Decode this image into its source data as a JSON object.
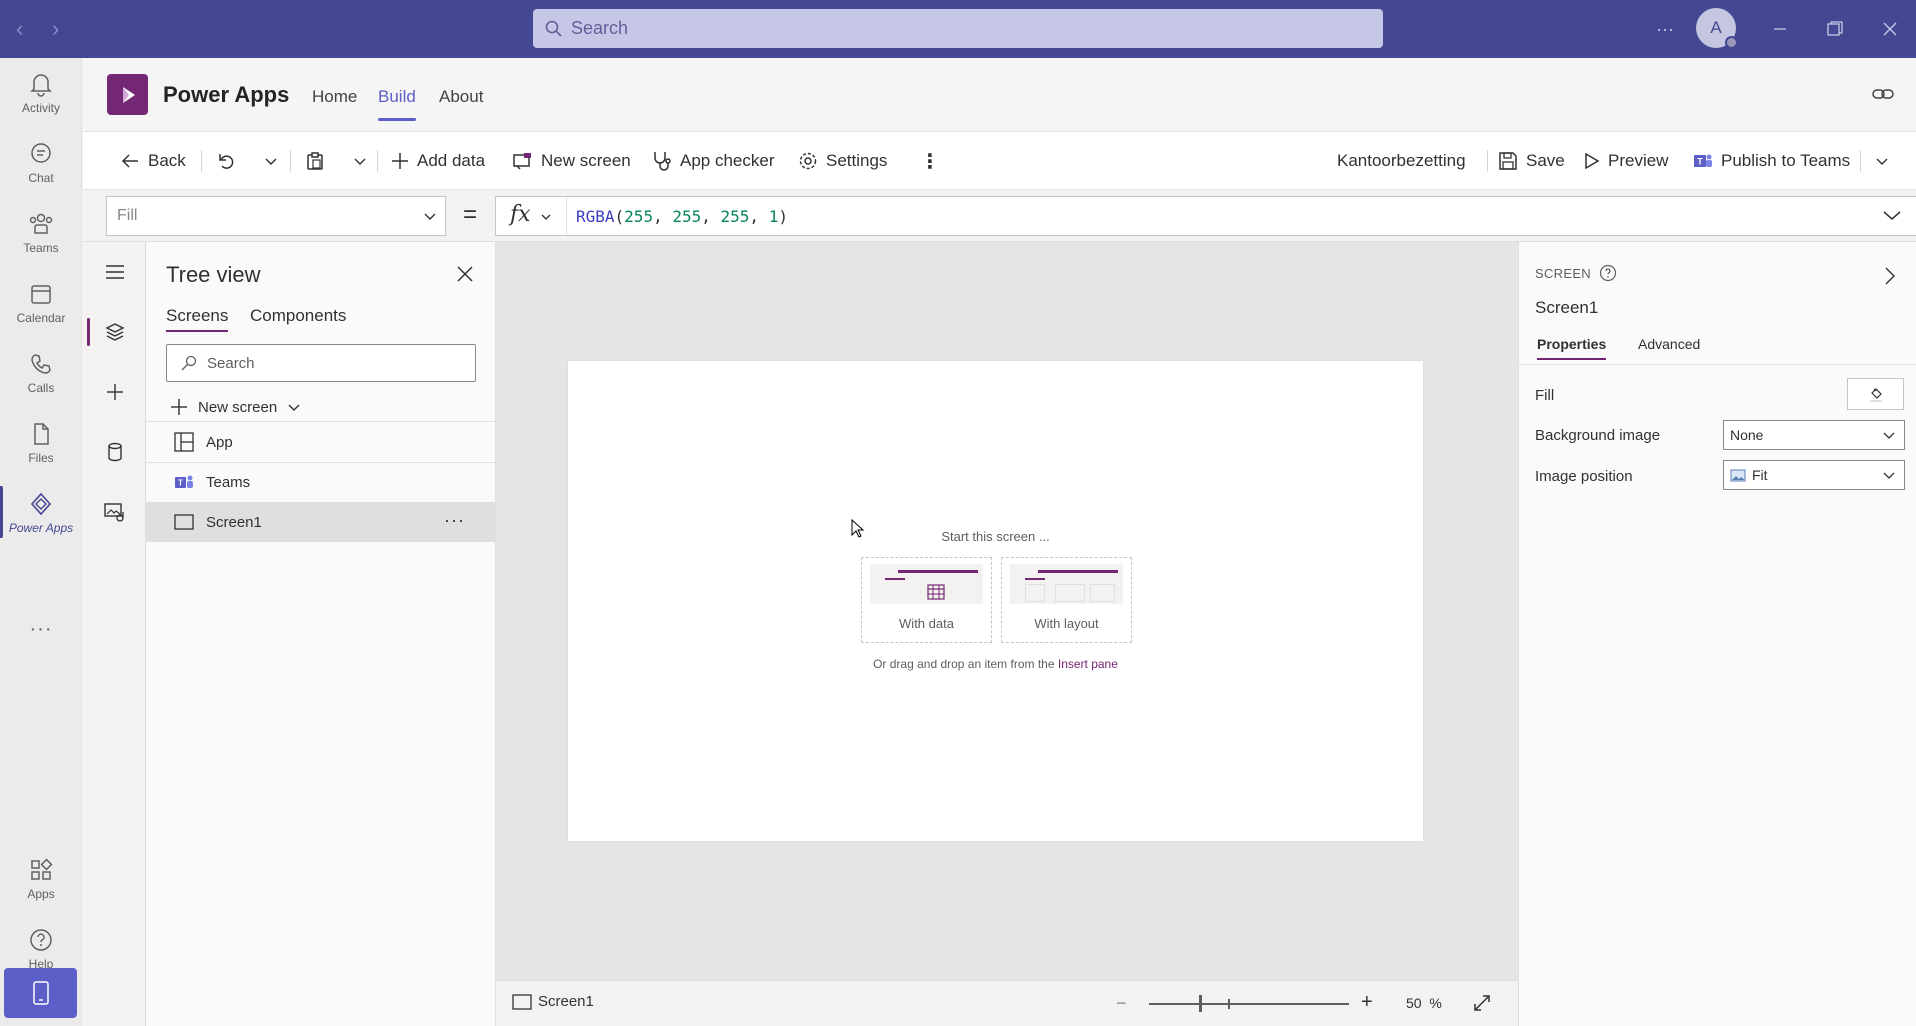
{
  "titlebar": {
    "search_placeholder": "Search",
    "avatar_initial": "A",
    "more": "···"
  },
  "rail": {
    "items": [
      {
        "label": "Activity",
        "icon": "bell-icon"
      },
      {
        "label": "Chat",
        "icon": "chat-icon"
      },
      {
        "label": "Teams",
        "icon": "teams-icon"
      },
      {
        "label": "Calendar",
        "icon": "calendar-icon"
      },
      {
        "label": "Calls",
        "icon": "phone-icon"
      },
      {
        "label": "Files",
        "icon": "file-icon"
      },
      {
        "label": "Power Apps",
        "icon": "power-apps-icon"
      }
    ],
    "more": "···",
    "bottom_items": [
      {
        "label": "Apps",
        "icon": "apps-icon"
      },
      {
        "label": "Help",
        "icon": "help-icon"
      }
    ]
  },
  "app": {
    "name": "Power Apps",
    "tabs": [
      "Home",
      "Build",
      "About"
    ],
    "active_tab": "Build"
  },
  "commands": {
    "back": "Back",
    "add_data": "Add data",
    "new_screen": "New screen",
    "app_checker": "App checker",
    "settings": "Settings",
    "more": "⋮",
    "team_name": "Kantoorbezetting",
    "save": "Save",
    "preview": "Preview",
    "publish": "Publish to Teams"
  },
  "formula_bar": {
    "property": "Fill",
    "equals": "=",
    "fx": "fx",
    "fn": "RGBA",
    "open": "(",
    "arg1": "255",
    "comma1": ", ",
    "arg2": "255",
    "comma2": ", ",
    "arg3": "255",
    "comma3": ", ",
    "arg4": "1",
    "close": ")"
  },
  "tree": {
    "title": "Tree view",
    "tabs": [
      "Screens",
      "Components"
    ],
    "search_placeholder": "Search",
    "new_screen": "New screen",
    "nodes": [
      {
        "label": "App"
      },
      {
        "label": "Teams"
      },
      {
        "label": "Screen1"
      }
    ],
    "node_more": "···"
  },
  "canvas": {
    "start_text": "Start this screen ...",
    "with_data": "With data",
    "with_layout": "With layout",
    "drag_text": "Or drag and drop an item from the",
    "insert_pane": "Insert pane"
  },
  "statusbar": {
    "screen": "Screen1",
    "zoom_minus": "−",
    "zoom_plus": "+",
    "zoom_value": "50",
    "zoom_unit": "%",
    "zoom_level": 0.5
  },
  "properties": {
    "type": "SCREEN",
    "name": "Screen1",
    "tabs": [
      "Properties",
      "Advanced"
    ],
    "active_tab": "Properties",
    "fill_label": "Fill",
    "bg_image_label": "Background image",
    "bg_image_value": "None",
    "image_position_label": "Image position",
    "image_position_value": "Fit"
  },
  "colors": {
    "teams_purple": "#444791",
    "power_apps_purple": "#742774",
    "accent": "#5b5fc7"
  }
}
